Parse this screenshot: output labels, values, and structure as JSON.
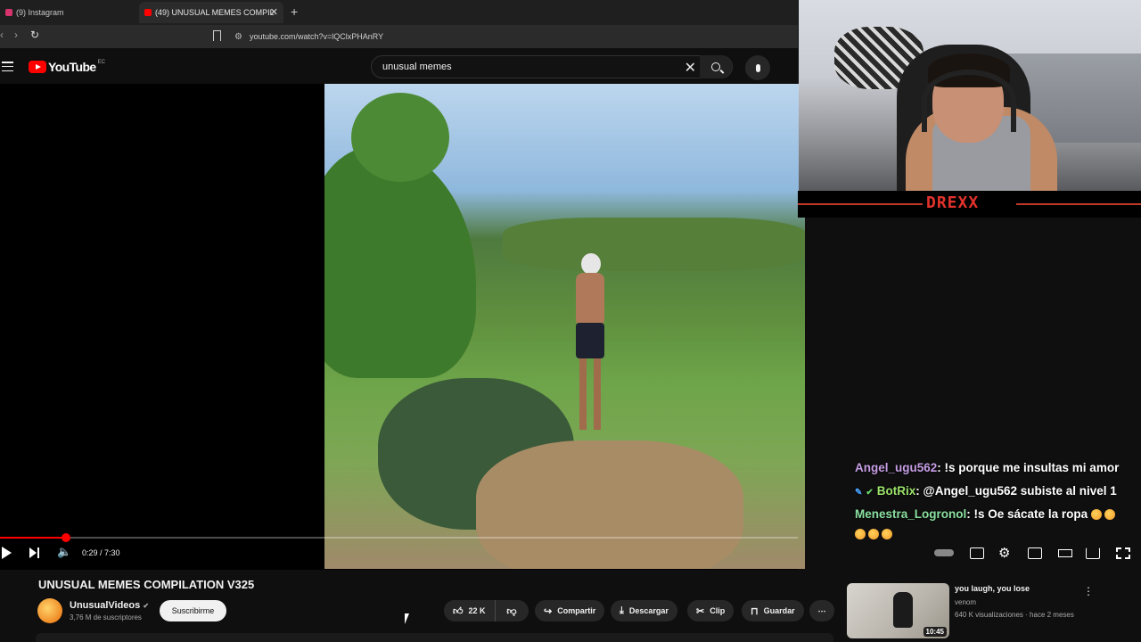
{
  "browser": {
    "tabs": [
      {
        "label": "(9) Instagram"
      },
      {
        "label": "(49) UNUSUAL MEMES COMPIL"
      }
    ],
    "url": "youtube.com/watch?v=lQClxPHAnRY"
  },
  "youtube": {
    "logo_text": "YouTube",
    "country_code": "EC",
    "search_query": "unusual memes"
  },
  "player": {
    "current_time": "0:29",
    "duration": "7:30",
    "time_display": "0:29 / 7:30",
    "progress_fraction": 0.066
  },
  "video": {
    "title": "UNUSUAL MEMES COMPILATION V325",
    "channel": "UnusualVideos",
    "subscribers": "3,76 M de suscriptores",
    "subscribe_label": "Suscribirme",
    "likes": "22 K",
    "share_label": "Compartir",
    "download_label": "Descargar",
    "clip_label": "Clip",
    "save_label": "Guardar"
  },
  "recommendation": {
    "title": "you laugh, you lose",
    "channel": "venom",
    "meta": "640 K visualizaciones · hace 2 meses",
    "duration": "10:45"
  },
  "stream": {
    "brand": "DREXX",
    "chat": [
      {
        "user": "Angel_ugu562",
        "message": ": !s porque me insultas mi amor"
      },
      {
        "user": "BotRix",
        "message": ": @Angel_ugu562 subiste al nivel 1"
      },
      {
        "user": "Menestra_Logronol",
        "message": ": !s Oe sácate la ropa"
      }
    ]
  },
  "colors": {
    "yt_red": "#ff0000",
    "bg": "#0f0f0f",
    "brand_red": "#e2322c"
  }
}
